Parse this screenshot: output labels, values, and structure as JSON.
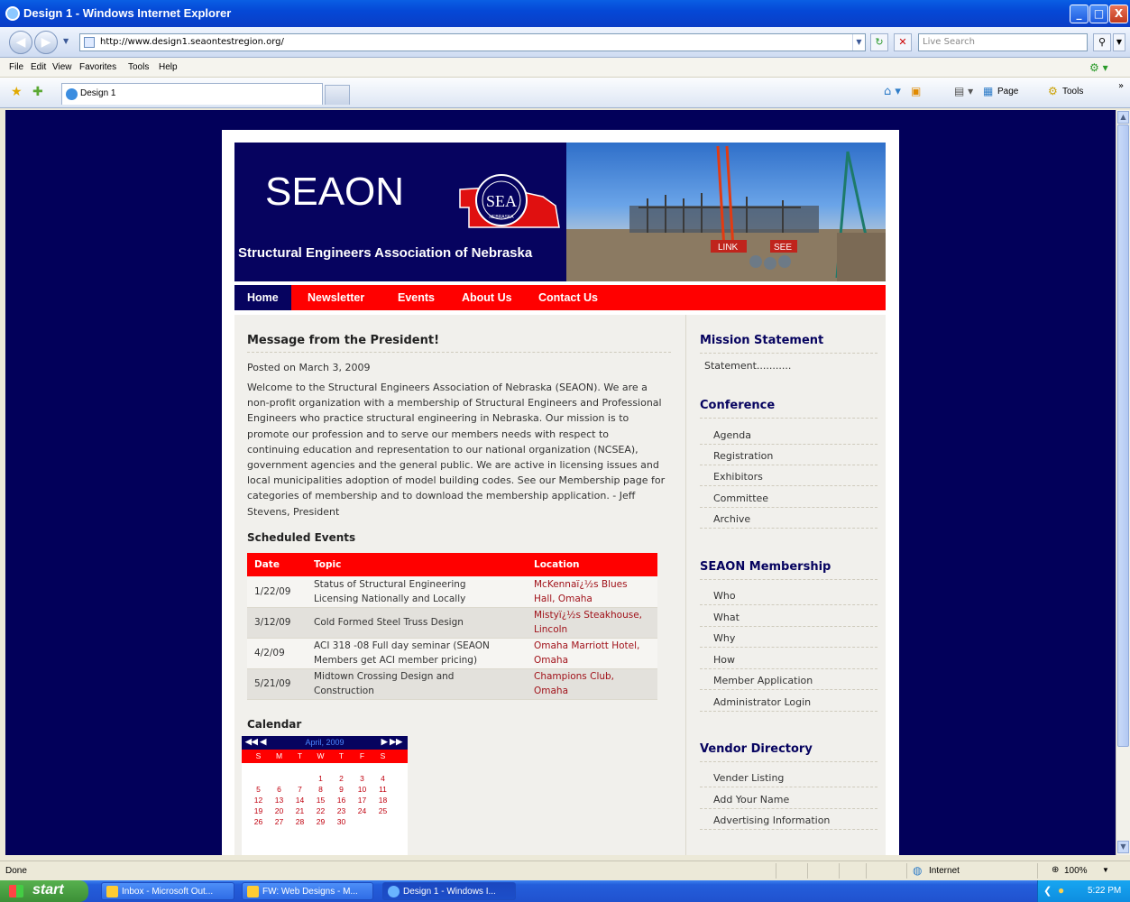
{
  "window": {
    "title": "Design 1 - Windows Internet Explorer",
    "min": "_",
    "max": "□",
    "close": "X"
  },
  "browser": {
    "url": "http://www.design1.seaontestregion.org/",
    "search_placeholder": "Live Search",
    "menu": [
      "File",
      "Edit",
      "View",
      "Favorites",
      "Tools",
      "Help"
    ],
    "tab_title": "Design 1",
    "cmd_page": "Page",
    "cmd_tools": "Tools"
  },
  "site": {
    "logo_text": "SEAON",
    "seal_text": "SEA",
    "seal_state": "NEBRASKA",
    "subtitle": "Structural Engineers Association of Nebraska",
    "photo_sign_1": "LINK",
    "photo_sign_2": "SEE",
    "nav": [
      "Home",
      "Newsletter",
      "Events",
      "About Us",
      "Contact Us"
    ]
  },
  "post": {
    "title": "Message from the President!",
    "date": "Posted on March 3, 2009",
    "body_lines": [
      "Welcome to the Structural Engineers Association of Nebraska (SEAON). We are a",
      "non-profit organization with a membership of Structural Engineers and Professional",
      "Engineers who practice structural engineering in Nebraska. Our mission is to",
      "promote our profession and to serve our members needs with respect to",
      "continuing education and representation to our national organization (NCSEA),",
      "government agencies and the general public. We are active in licensing issues and",
      "local municipalities adoption of model building codes. See our Membership page for",
      "categories of membership and to download the membership application. - Jeff",
      "Stevens, President"
    ]
  },
  "events": {
    "heading": "Scheduled Events",
    "columns": [
      "Date",
      "Topic",
      "Location"
    ],
    "rows": [
      {
        "date": "1/22/09",
        "topic": [
          "Status of Structural Engineering",
          "Licensing Nationally and Locally"
        ],
        "location": [
          "McKennaï¿½s Blues",
          "Hall, Omaha"
        ]
      },
      {
        "date": "3/12/09",
        "topic": [
          "Cold Formed Steel Truss Design"
        ],
        "location": [
          "Mistyï¿½s Steakhouse,",
          "Lincoln"
        ]
      },
      {
        "date": "4/2/09",
        "topic": [
          "ACI 318 -08 Full day seminar (SEAON",
          "Members get ACI member pricing)"
        ],
        "location": [
          "Omaha Marriott Hotel,",
          "Omaha"
        ]
      },
      {
        "date": "5/21/09",
        "topic": [
          "Midtown Crossing Design and",
          "Construction"
        ],
        "location": [
          "Champions Club,",
          "Omaha"
        ]
      }
    ]
  },
  "calendar": {
    "heading": "Calendar",
    "month": "April, 2009",
    "prev": "◀◀ ◀",
    "next": "▶ ▶▶",
    "weekdays": [
      "S",
      "M",
      "T",
      "W",
      "T",
      "F",
      "S"
    ],
    "weeks": [
      [
        "",
        "",
        "",
        "1",
        "2",
        "3",
        "4"
      ],
      [
        "5",
        "6",
        "7",
        "8",
        "9",
        "10",
        "11"
      ],
      [
        "12",
        "13",
        "14",
        "15",
        "16",
        "17",
        "18"
      ],
      [
        "19",
        "20",
        "21",
        "22",
        "23",
        "24",
        "25"
      ],
      [
        "26",
        "27",
        "28",
        "29",
        "30",
        "",
        ""
      ]
    ]
  },
  "sidebar": {
    "mission_heading": "Mission Statement",
    "mission_text": "Statement...........",
    "sections": [
      {
        "heading": "Conference",
        "links": [
          "Agenda",
          "Registration",
          "Exhibitors",
          "Committee",
          "Archive"
        ]
      },
      {
        "heading": "SEAON Membership",
        "links": [
          "Who",
          "What",
          "Why",
          "How",
          "Member Application",
          "Administrator Login"
        ]
      },
      {
        "heading": "Vendor Directory",
        "links": [
          "Vender Listing",
          "Add Your Name",
          "Advertising Information"
        ]
      }
    ]
  },
  "statusbar": {
    "text": "Done",
    "zone": "Internet",
    "zoom": "100%"
  },
  "taskbar": {
    "start": "start",
    "tasks": [
      "Inbox - Microsoft Out...",
      "FW: Web Designs - M...",
      "Design 1 - Windows I..."
    ],
    "clock": "5:22 PM"
  },
  "colors": {
    "navy": "#06035f",
    "red": "#ff0000",
    "page_bg": "#02005a",
    "link_red": "#a1131b"
  }
}
